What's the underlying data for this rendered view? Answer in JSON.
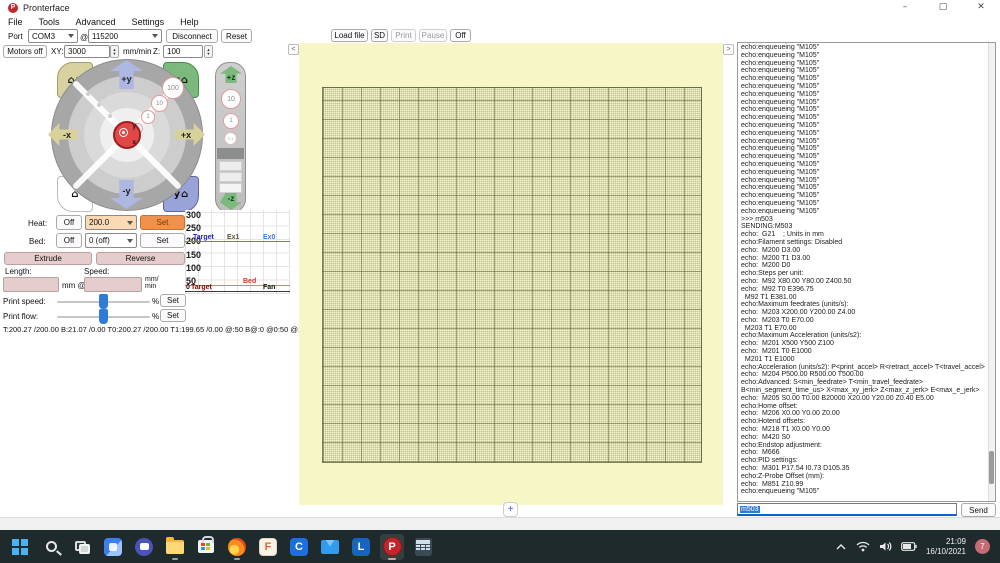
{
  "window": {
    "title": "Pronterface",
    "minimize": "–",
    "maximize": "▢",
    "close": "✕"
  },
  "menu": {
    "items": [
      "File",
      "Tools",
      "Advanced",
      "Settings",
      "Help"
    ]
  },
  "toolbar": {
    "port_label": "Port",
    "port_value": "COM3",
    "at_label": "@",
    "baud_value": "115200",
    "disconnect_label": "Disconnect",
    "reset_label": "Reset",
    "load_file_label": "Load file",
    "sd_label": "SD",
    "print_label": "Print",
    "pause_label": "Pause",
    "off_label": "Off"
  },
  "motion_row": {
    "motors_off_label": "Motors off",
    "xy_label": "XY:",
    "xy_value": "3000",
    "units_label": "mm/min",
    "z_label": "Z:",
    "z_value": "100"
  },
  "jog": {
    "plus_y": "+y",
    "minus_y": "-y",
    "plus_x": "+x",
    "minus_x": "-x",
    "home_icon": "⌂",
    "home_x_label": "x",
    "home_z_label": "z",
    "home_y_label": "y",
    "step_labels": [
      "100",
      "10",
      "1",
      "0.1"
    ],
    "center_y": "y",
    "center_x": "x"
  },
  "z_control": {
    "plus_z": "+z",
    "minus_z": "-z",
    "steps": [
      "10",
      "1",
      "0.1"
    ]
  },
  "heater": {
    "heat_label": "Heat:",
    "heat_off_label": "Off",
    "heat_value": "200.0",
    "heat_set_label": "Set",
    "bed_label": "Bed:",
    "bed_off_label": "Off",
    "bed_value": "0 (off)",
    "bed_set_label": "Set"
  },
  "extrusion": {
    "extrude_label": "Extrude",
    "reverse_label": "Reverse",
    "length_label": "Length:",
    "speed_label": "Speed:",
    "length_value": "",
    "speed_value": "",
    "mm_at_label": "mm @",
    "mm_min_line1": "mm/",
    "mm_min_line2": "min"
  },
  "speeds": {
    "print_speed_label": "Print speed:",
    "print_flow_label": "Print flow:",
    "percent_label": "%",
    "set_label": "Set"
  },
  "status_line": "T:200.27 /200.00 B:21.07 /0.00 T0:200.27 /200.00 T1:199.65 /0.00 @:50 B@:0 @0:50 @1:0",
  "graph": {
    "ticks": [
      "300",
      "250",
      "200",
      "150",
      "100",
      "50"
    ],
    "zero_label": "0",
    "target_ex_label": "Target",
    "ex1_label": "Ex1",
    "ex0_label": "Ex0",
    "bed_label": "Bed",
    "target_bed_label": "Target",
    "fan_label": "Fan",
    "colors": {
      "ex_line": "#7f7f58",
      "bed_line": "#ff7070",
      "target_blue": "#2222cc",
      "ex0_blue": "#2d7ff0",
      "bed_red": "#e03030",
      "fan_black": "#111111"
    }
  },
  "panel_nav": {
    "collapse_left": "<",
    "collapse_right": ">",
    "add_label": "+"
  },
  "log": {
    "lines": [
      "echo:enqueueing \"M105\"",
      "echo:enqueueing \"M105\"",
      "echo:enqueueing \"M105\"",
      "echo:enqueueing \"M105\"",
      "echo:enqueueing \"M105\"",
      "echo:enqueueing \"M105\"",
      "echo:enqueueing \"M105\"",
      "echo:enqueueing \"M105\"",
      "echo:enqueueing \"M105\"",
      "echo:enqueueing \"M105\"",
      "echo:enqueueing \"M105\"",
      "echo:enqueueing \"M105\"",
      "echo:enqueueing \"M105\"",
      "echo:enqueueing \"M105\"",
      "echo:enqueueing \"M105\"",
      "echo:enqueueing \"M105\"",
      "echo:enqueueing \"M105\"",
      "echo:enqueueing \"M105\"",
      "echo:enqueueing \"M105\"",
      "echo:enqueueing \"M105\"",
      "echo:enqueueing \"M105\"",
      "echo:enqueueing \"M105\"",
      ">>> m503",
      "SENDING:M503",
      "echo:  G21    ; Units in mm",
      "echo:Filament settings: Disabled",
      "echo:  M200 D3.00",
      "echo:  M200 T1 D3.00",
      "echo:  M200 D0",
      "echo:Steps per unit:",
      "echo:  M92 X80.00 Y80.00 Z400.50",
      "echo:  M92 T0 E396.75",
      "  M92 T1 E381.00",
      "echo:Maximum feedrates (units/s):",
      "echo:  M203 X200.00 Y200.00 Z4.00",
      "echo:  M203 T0 E70.00",
      "  M203 T1 E70.00",
      "echo:Maximum Acceleration (units/s2):",
      "echo:  M201 X500 Y500 Z100",
      "echo:  M201 T0 E1000",
      "  M201 T1 E1000",
      "echo:Acceleration (units/s2): P<print_accel> R<retract_accel> T<travel_accel>",
      "echo:  M204 P500.00 R500.00 T500.00",
      "echo:Advanced: S<min_feedrate> T<min_travel_feedrate>",
      "B<min_segment_time_us> X<max_xy_jerk> Z<max_z_jerk> E<max_e_jerk>",
      "echo:  M205 S0.00 T0.00 B20000 X20.00 Y20.00 Z0.40 E5.00",
      "echo:Home offset:",
      "echo:  M206 X0.00 Y0.00 Z0.00",
      "echo:Hotend offsets:",
      "echo:  M218 T1 X0.00 Y0.00",
      "echo:  M420 S0",
      "echo:Endstop adjustment:",
      "echo:  M666",
      "echo:PID settings:",
      "echo:  M301 P17.54 I0.73 D105.35",
      "echo:Z-Probe Offset (mm):",
      "echo:  M851 Z10.99",
      "echo:enqueueing \"M105\""
    ],
    "input_value": "m503",
    "send_label": "Send"
  },
  "taskbar": {
    "icon_names": [
      "start-icon",
      "search-icon",
      "task-view-icon",
      "widgets-icon",
      "chat-icon",
      "file-explorer-icon",
      "store-icon",
      "firefox-icon",
      "f-app-icon",
      "cura-icon",
      "mail-icon",
      "l-app-icon",
      "pronterface-icon",
      "calculator-icon"
    ],
    "f_app_letter": "F",
    "cura_letter": "C",
    "l_app_letter": "L",
    "pronterface_letter": "P",
    "time": "21:09",
    "date": "16/10/2021",
    "badge": "7"
  }
}
